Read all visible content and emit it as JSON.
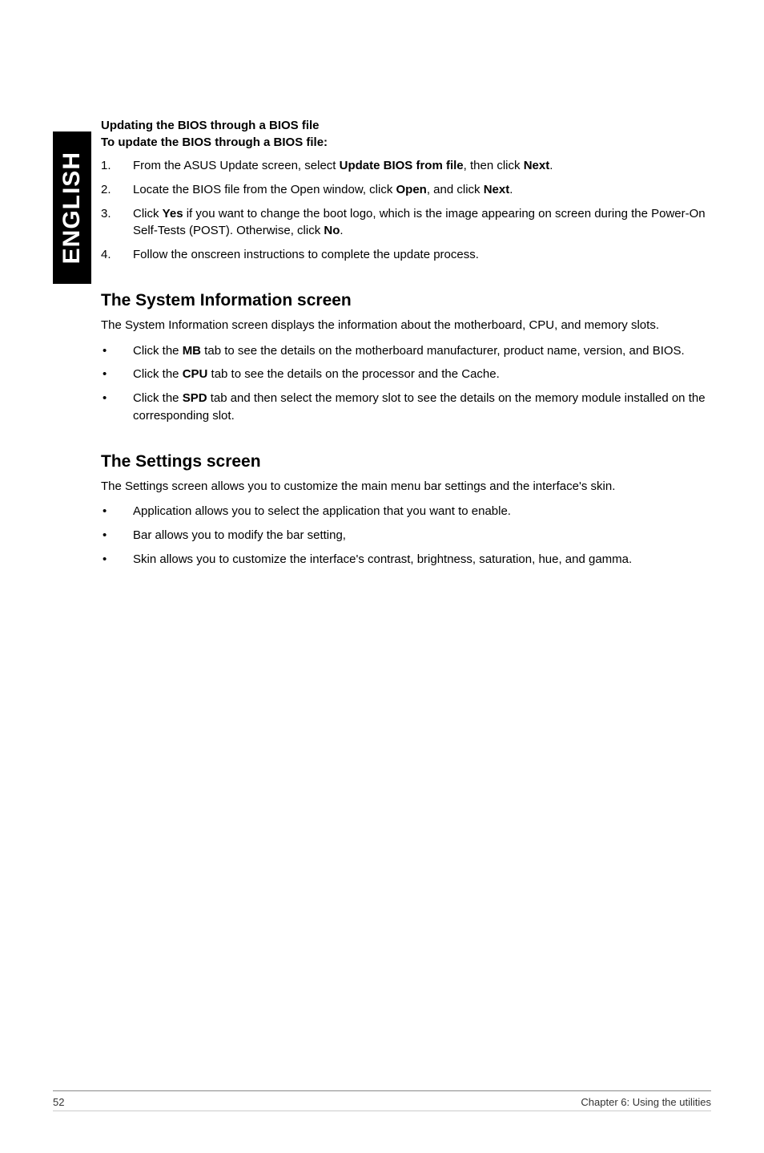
{
  "sidebar": {
    "label": "ENGLISH"
  },
  "section1": {
    "heading": "Updating the BIOS through a BIOS file",
    "subheading": "To update the BIOS through a BIOS file:",
    "items": [
      {
        "num": "1.",
        "pre": "From the ASUS Update screen, select ",
        "bold1": "Update BIOS from file",
        "mid": ", then click ",
        "bold2": "Next",
        "post": "."
      },
      {
        "num": "2.",
        "pre": "Locate the BIOS file from the Open window, click ",
        "bold1": "Open",
        "mid": ", and click ",
        "bold2": "Next",
        "post": "."
      },
      {
        "num": "3.",
        "pre": "Click ",
        "bold1": "Yes",
        "mid": " if you want to change the boot logo, which is the image appearing on screen during the Power-On Self-Tests (POST). Otherwise, click ",
        "bold2": "No",
        "post": "."
      },
      {
        "num": "4.",
        "pre": "Follow the onscreen instructions to complete the update process.",
        "bold1": "",
        "mid": "",
        "bold2": "",
        "post": ""
      }
    ]
  },
  "section2": {
    "heading": "The System Information screen",
    "para": "The System Information screen displays the information about the motherboard, CPU, and memory slots.",
    "items": [
      {
        "pre": "Click the ",
        "bold": "MB",
        "post": " tab to see the details on the motherboard manufacturer, product name, version, and BIOS."
      },
      {
        "pre": "Click the ",
        "bold": "CPU",
        "post": " tab to see the details on the processor and the Cache."
      },
      {
        "pre": "Click the ",
        "bold": "SPD",
        "post": " tab and then select the memory slot to see the details on the memory module installed on the corresponding slot."
      }
    ]
  },
  "section3": {
    "heading": "The Settings screen",
    "para": "The Settings screen allows you to customize the main menu bar settings and the interface's skin.",
    "items": [
      {
        "text": "Application allows you to select the application that you want to enable."
      },
      {
        "text": "Bar allows you to modify the bar setting,"
      },
      {
        "text": "Skin allows you to customize the interface's contrast, brightness, saturation, hue, and gamma."
      }
    ]
  },
  "footer": {
    "page": "52",
    "chapter": "Chapter 6: Using the utilities"
  }
}
